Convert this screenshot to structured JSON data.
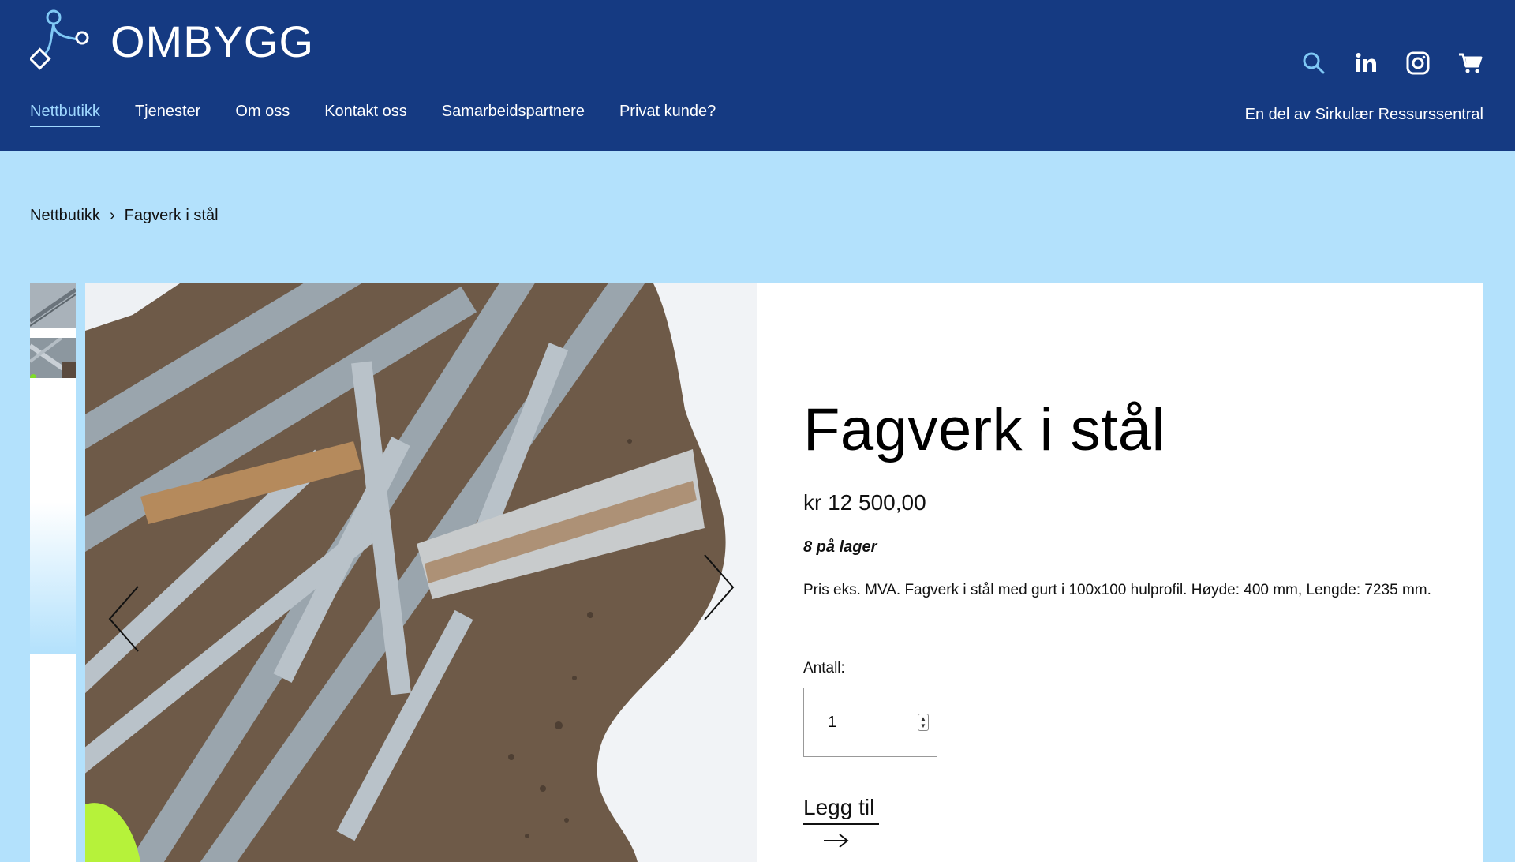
{
  "brand": {
    "name": "OMBYGG"
  },
  "header": {
    "icons": [
      "search-icon",
      "linkedin-icon",
      "instagram-icon",
      "cart-icon"
    ],
    "partner_text": "En del av Sirkulær Ressurssentral"
  },
  "nav": {
    "items": [
      {
        "label": "Nettbutikk",
        "active": true
      },
      {
        "label": "Tjenester"
      },
      {
        "label": "Om oss"
      },
      {
        "label": "Kontakt oss"
      },
      {
        "label": "Samarbeidspartnere"
      },
      {
        "label": "Privat kunde?"
      }
    ]
  },
  "breadcrumb": {
    "items": [
      "Nettbutikk",
      "Fagverk i stål"
    ],
    "separator": "›"
  },
  "product": {
    "title": "Fagverk i stål",
    "price": "kr 12 500,00",
    "stock": "8 på lager",
    "description": "Pris eks. MVA. Fagverk i stål med gurt i 100x100 hulprofil. Høyde: 400 mm, Lengde: 7235 mm.",
    "quantity_label": "Antall:",
    "quantity_value": "1",
    "add_to_cart": "Legg til"
  },
  "colors": {
    "header_bg": "#153a82",
    "page_bg": "#b3e1fc",
    "nav_active": "#9fd8ff"
  }
}
